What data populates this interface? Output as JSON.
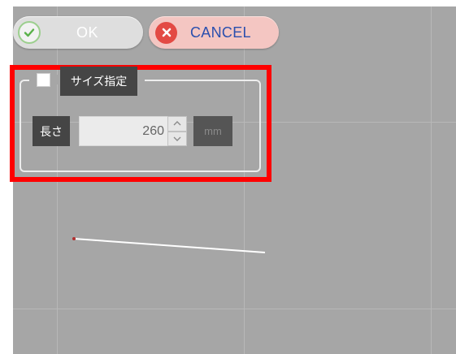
{
  "toolbar": {
    "ok_label": "OK",
    "cancel_label": "CANCEL"
  },
  "size_group": {
    "title": "サイズ指定",
    "checked": false,
    "length_label": "長さ",
    "length_value": "260",
    "unit": "mm"
  },
  "icons": {
    "ok": "check-circle-icon",
    "cancel": "x-circle-icon",
    "spin_up": "triangle-up-icon",
    "spin_down": "triangle-down-icon"
  },
  "colors": {
    "highlight": "#ff0000",
    "ok_check": "#5ab14a",
    "cancel_icon": "#e34a44",
    "cancel_text": "#2a4fae",
    "canvas": "#a6a6a6"
  }
}
